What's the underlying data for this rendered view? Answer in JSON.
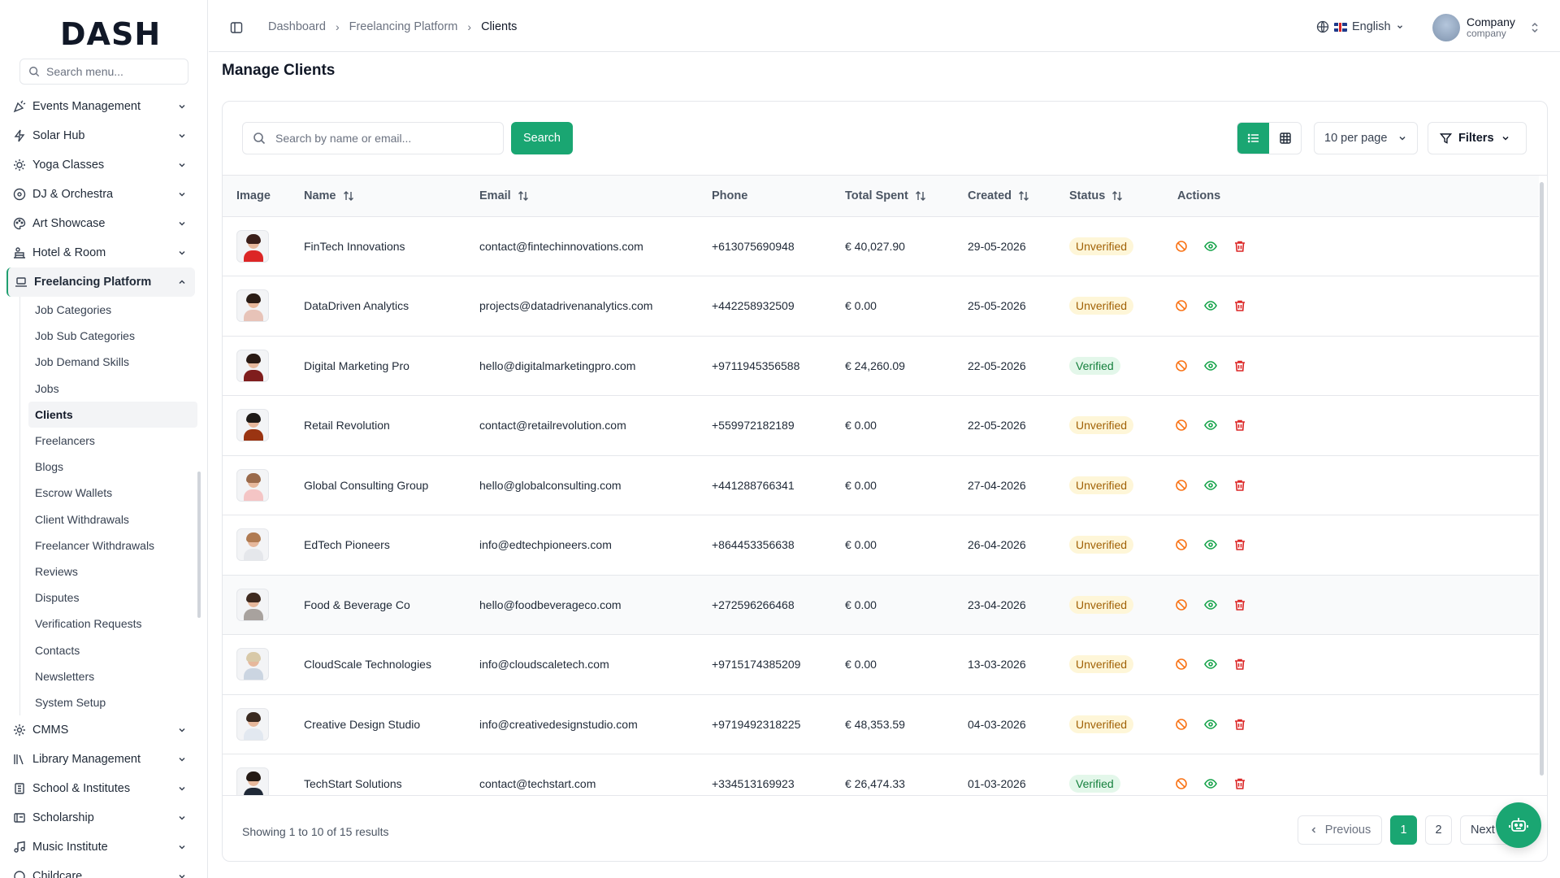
{
  "app": {
    "logo": "DASH"
  },
  "sidebar": {
    "search_placeholder": "Search menu...",
    "items": [
      {
        "label": "Events Management",
        "icon": "events-icon"
      },
      {
        "label": "Solar Hub",
        "icon": "solar-icon"
      },
      {
        "label": "Yoga Classes",
        "icon": "yoga-icon"
      },
      {
        "label": "DJ & Orchestra",
        "icon": "music-disc-icon"
      },
      {
        "label": "Art Showcase",
        "icon": "palette-icon"
      },
      {
        "label": "Hotel & Room",
        "icon": "hotel-icon"
      },
      {
        "label": "Freelancing Platform",
        "icon": "laptop-icon"
      }
    ],
    "sub_items": [
      "Job Categories",
      "Job Sub Categories",
      "Job Demand Skills",
      "Jobs",
      "Clients",
      "Freelancers",
      "Blogs",
      "Escrow Wallets",
      "Client Withdrawals",
      "Freelancer Withdrawals",
      "Reviews",
      "Disputes",
      "Verification Requests",
      "Contacts",
      "Newsletters",
      "System Setup"
    ],
    "items_after": [
      {
        "label": "CMMS",
        "icon": "gear-icon"
      },
      {
        "label": "Library Management",
        "icon": "library-icon"
      },
      {
        "label": "School & Institutes",
        "icon": "school-icon"
      },
      {
        "label": "Scholarship",
        "icon": "scholarship-icon"
      },
      {
        "label": "Music Institute",
        "icon": "music-note-icon"
      },
      {
        "label": "Childcare",
        "icon": "childcare-icon"
      }
    ]
  },
  "header": {
    "breadcrumb": [
      "Dashboard",
      "Freelancing Platform",
      "Clients"
    ],
    "language": "English",
    "company_name": "Company",
    "company_sub": "company"
  },
  "page": {
    "title": "Manage Clients",
    "search_placeholder": "Search by name or email...",
    "search_button": "Search",
    "per_page": "10 per page",
    "filters": "Filters"
  },
  "table": {
    "columns": [
      "Image",
      "Name",
      "Email",
      "Phone",
      "Total Spent",
      "Created",
      "Status",
      "Actions"
    ],
    "rows": [
      {
        "name": "FinTech Innovations",
        "email": "contact@fintechinnovations.com",
        "phone": "+613075690948",
        "spent": "€ 40,027.90",
        "created": "29-05-2026",
        "status": "Unverified"
      },
      {
        "name": "DataDriven Analytics",
        "email": "projects@datadrivenanalytics.com",
        "phone": "+442258932509",
        "spent": "€ 0.00",
        "created": "25-05-2026",
        "status": "Unverified"
      },
      {
        "name": "Digital Marketing Pro",
        "email": "hello@digitalmarketingpro.com",
        "phone": "+9711945356588",
        "spent": "€ 24,260.09",
        "created": "22-05-2026",
        "status": "Verified"
      },
      {
        "name": "Retail Revolution",
        "email": "contact@retailrevolution.com",
        "phone": "+559972182189",
        "spent": "€ 0.00",
        "created": "22-05-2026",
        "status": "Unverified"
      },
      {
        "name": "Global Consulting Group",
        "email": "hello@globalconsulting.com",
        "phone": "+441288766341",
        "spent": "€ 0.00",
        "created": "27-04-2026",
        "status": "Unverified"
      },
      {
        "name": "EdTech Pioneers",
        "email": "info@edtechpioneers.com",
        "phone": "+864453356638",
        "spent": "€ 0.00",
        "created": "26-04-2026",
        "status": "Unverified"
      },
      {
        "name": "Food & Beverage Co",
        "email": "hello@foodbeverageco.com",
        "phone": "+272596266468",
        "spent": "€ 0.00",
        "created": "23-04-2026",
        "status": "Unverified"
      },
      {
        "name": "CloudScale Technologies",
        "email": "info@cloudscaletech.com",
        "phone": "+9715174385209",
        "spent": "€ 0.00",
        "created": "13-03-2026",
        "status": "Unverified"
      },
      {
        "name": "Creative Design Studio",
        "email": "info@creativedesignstudio.com",
        "phone": "+9719492318225",
        "spent": "€ 48,353.59",
        "created": "04-03-2026",
        "status": "Unverified"
      },
      {
        "name": "TechStart Solutions",
        "email": "contact@techstart.com",
        "phone": "+334513169923",
        "spent": "€ 26,474.33",
        "created": "01-03-2026",
        "status": "Verified"
      }
    ]
  },
  "pagination": {
    "showing": "Showing 1 to 10 of 15 results",
    "previous": "Previous",
    "pages": [
      "1",
      "2"
    ],
    "next": "Next"
  },
  "colors": {
    "accent": "#1aa672",
    "unverified_bg": "#fef6d8",
    "verified_bg": "#e3f7ea"
  }
}
